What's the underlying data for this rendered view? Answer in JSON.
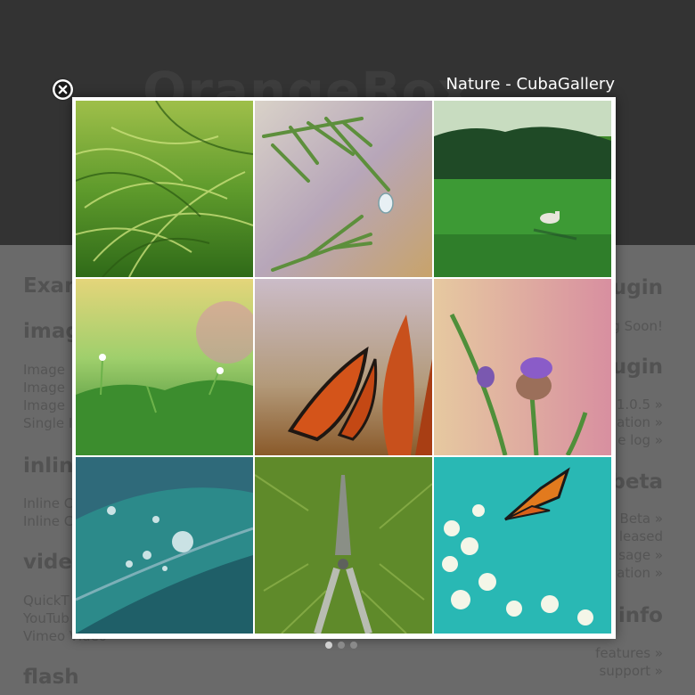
{
  "background_page": {
    "logo_text": "OrangeBox",
    "left_column": {
      "sections": [
        {
          "title": "Exam",
          "lines": []
        },
        {
          "title": "imag",
          "lines": [
            "Image",
            "Image",
            "Image",
            "Single I"
          ]
        },
        {
          "title": "inline",
          "lines": [
            "Inline C",
            "Inline C"
          ]
        },
        {
          "title": "vide",
          "lines": [
            "QuickT",
            "YouTub",
            "Vimeo Video"
          ]
        },
        {
          "title": "flash",
          "lines": []
        }
      ]
    },
    "right_column": {
      "sections": [
        {
          "title": "ugin",
          "lines": [
            "g Soon!"
          ]
        },
        {
          "title": "ugin",
          "lines": [
            "1.0.5 »",
            "ation »",
            "e log »"
          ]
        },
        {
          "title": "beta",
          "lines": [
            "Beta »",
            "leased",
            "sage »",
            "ation »"
          ]
        },
        {
          "title": "info",
          "lines": [
            "features »",
            "support »"
          ]
        }
      ]
    }
  },
  "lightbox": {
    "title": "Nature - CubaGallery",
    "close_icon": "close-circle-icon",
    "thumbnails": [
      {
        "subject": "grass"
      },
      {
        "subject": "pine-needles-dewdrop"
      },
      {
        "subject": "meadow-sheep"
      },
      {
        "subject": "small-flower-grass"
      },
      {
        "subject": "butterfly-on-flower"
      },
      {
        "subject": "purple-thistle"
      },
      {
        "subject": "leaf-water-drops"
      },
      {
        "subject": "garden-shears-grass"
      },
      {
        "subject": "butterfly-white-flowers"
      }
    ],
    "pager": {
      "pages": 3,
      "current": 1
    }
  },
  "colors": {
    "overlay_dark": "#333333",
    "overlay_body": "#6a6a6a",
    "frame": "#ffffff",
    "title": "#ffffff"
  }
}
